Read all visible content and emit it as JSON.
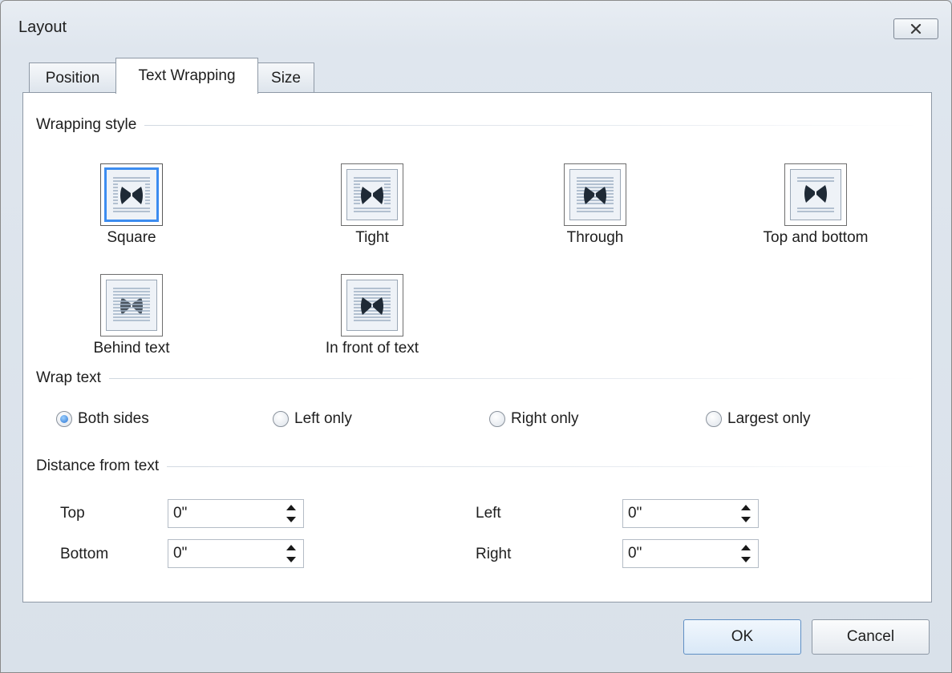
{
  "window": {
    "title": "Layout"
  },
  "tabs": [
    {
      "label": "Position"
    },
    {
      "label": "Text Wrapping"
    },
    {
      "label": "Size"
    }
  ],
  "wrapping_style": {
    "label": "Wrapping style",
    "options": [
      {
        "label": "Square",
        "icon": "wrap-square-icon",
        "selected": true
      },
      {
        "label": "Tight",
        "icon": "wrap-tight-icon",
        "selected": false
      },
      {
        "label": "Through",
        "icon": "wrap-through-icon",
        "selected": false
      },
      {
        "label": "Top and bottom",
        "icon": "wrap-top-bottom-icon",
        "selected": false
      },
      {
        "label": "Behind text",
        "icon": "wrap-behind-text-icon",
        "selected": false
      },
      {
        "label": "In front of text",
        "icon": "wrap-in-front-icon",
        "selected": false
      }
    ]
  },
  "wrap_text": {
    "label": "Wrap text",
    "options": [
      {
        "label": "Both sides",
        "checked": true
      },
      {
        "label": "Left only",
        "checked": false
      },
      {
        "label": "Right only",
        "checked": false
      },
      {
        "label": "Largest only",
        "checked": false
      }
    ]
  },
  "distance": {
    "label": "Distance from text",
    "top": {
      "label": "Top",
      "value": "0\""
    },
    "bottom": {
      "label": "Bottom",
      "value": "0\""
    },
    "left": {
      "label": "Left",
      "value": "0\""
    },
    "right": {
      "label": "Right",
      "value": "0\""
    }
  },
  "buttons": {
    "ok": "OK",
    "cancel": "Cancel"
  },
  "colors": {
    "selection_accent": "#3c8cf0",
    "radio_checked": "#2a74d2"
  }
}
